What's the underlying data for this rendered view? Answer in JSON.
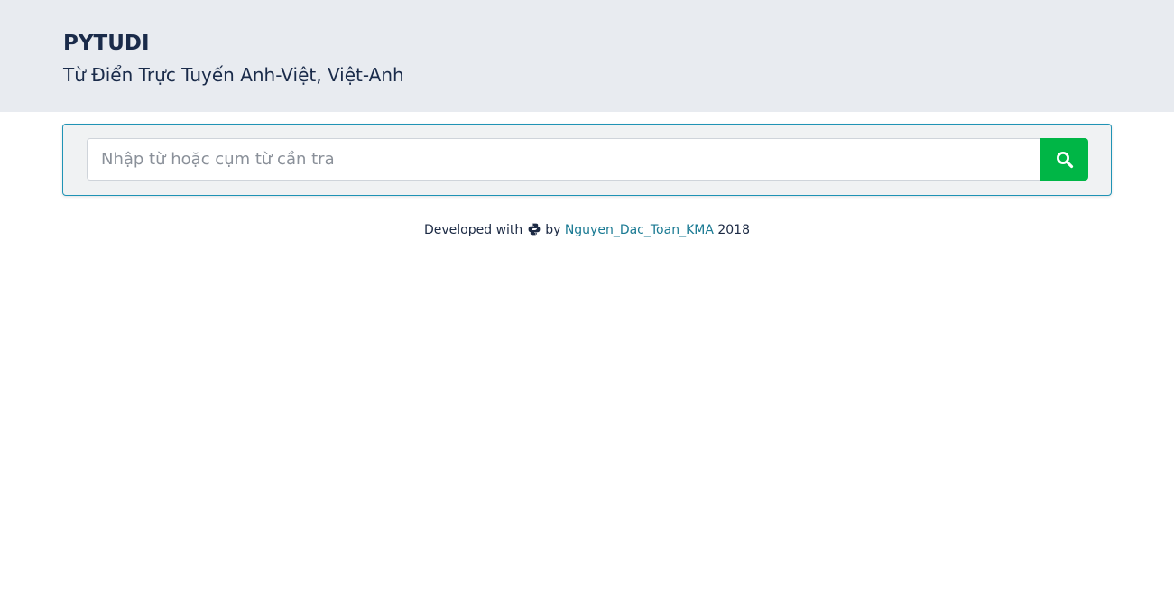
{
  "header": {
    "brand": "PYTUDI",
    "subtitle": "Từ Điển Trực Tuyến Anh-Việt, Việt-Anh"
  },
  "search": {
    "placeholder": "Nhập từ hoặc cụm từ cần tra",
    "value": "",
    "button_icon": "search-icon"
  },
  "footer": {
    "prefix": "Developed with",
    "icon": "python-icon",
    "by": "by",
    "author": "Nguyen_Dac_Toan_KMA",
    "year": "2018"
  },
  "colors": {
    "header_bg": "#e8ebf0",
    "panel_border": "#1f93b5",
    "button": "#00b646",
    "link": "#1a7a93"
  }
}
